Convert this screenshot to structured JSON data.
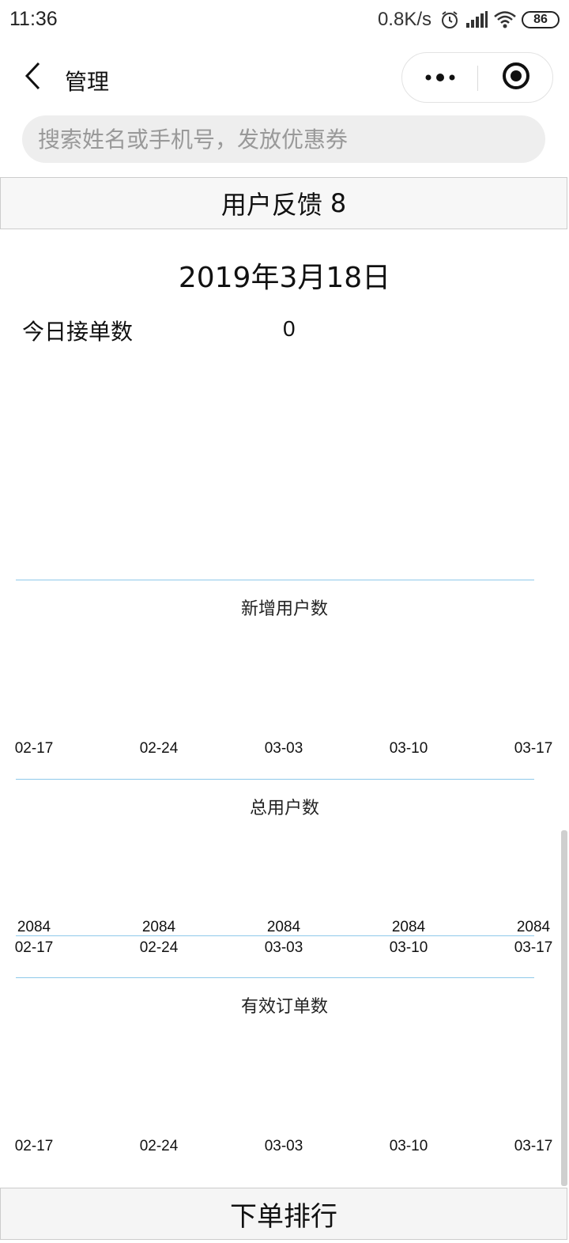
{
  "status_bar": {
    "time": "11:36",
    "net_speed": "0.8K/s",
    "battery": "86",
    "icons": [
      "alarm-icon",
      "signal-icon",
      "wifi-icon",
      "battery-icon"
    ]
  },
  "nav": {
    "title": "管理",
    "back_icon": "chevron-left-icon",
    "more_icon": "more-dots-icon",
    "close_icon": "target-close-icon"
  },
  "search": {
    "placeholder": "搜索姓名或手机号，发放优惠券",
    "value": ""
  },
  "feedback": {
    "label": "用户反馈",
    "count": "8"
  },
  "summary": {
    "date": "2019年3月18日",
    "today_orders_label": "今日接单数",
    "today_orders_value": "0"
  },
  "chart_data": [
    {
      "type": "line",
      "title": "新增用户数",
      "x": [
        "02-17",
        "02-24",
        "03-03",
        "03-10",
        "03-17"
      ],
      "series": [
        {
          "values": []
        }
      ],
      "data_labels": []
    },
    {
      "type": "line",
      "title": "总用户数",
      "x": [
        "02-17",
        "02-24",
        "03-03",
        "03-10",
        "03-17"
      ],
      "series": [
        {
          "values": [
            2084,
            2084,
            2084,
            2084,
            2084
          ]
        }
      ],
      "data_labels": [
        "2084",
        "2084",
        "2084",
        "2084",
        "2084"
      ]
    },
    {
      "type": "line",
      "title": "有效订单数",
      "x": [
        "02-17",
        "02-24",
        "03-03",
        "03-10",
        "03-17"
      ],
      "series": [
        {
          "values": []
        }
      ],
      "data_labels": []
    }
  ],
  "colors": {
    "line": "#8ec9ea",
    "border": "#cccccc",
    "search_bg": "#eeeeee"
  },
  "ranking": {
    "label": "下单排行"
  }
}
